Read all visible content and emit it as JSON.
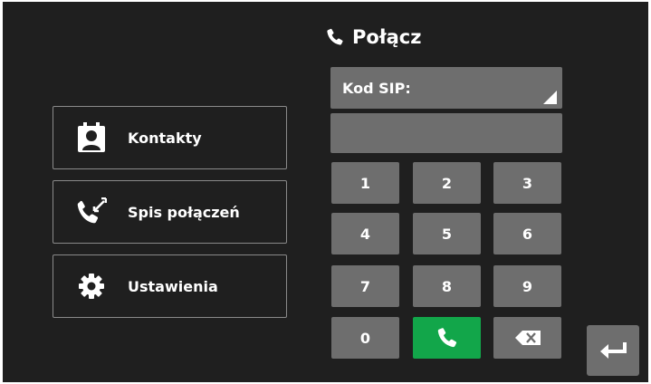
{
  "header": {
    "title": "Połącz",
    "icon": "phone-icon"
  },
  "menu": [
    {
      "label": "Kontakty",
      "icon": "contacts-icon"
    },
    {
      "label": "Spis połączeń",
      "icon": "call-log-icon"
    },
    {
      "label": "Ustawienia",
      "icon": "gear-icon"
    }
  ],
  "sip": {
    "label": "Kod SIP:",
    "value": ""
  },
  "keypad": {
    "keys": [
      "1",
      "2",
      "3",
      "4",
      "5",
      "6",
      "7",
      "8",
      "9",
      "0"
    ],
    "call_icon": "phone-icon",
    "backspace_icon": "backspace-icon"
  },
  "back_icon": "return-arrow-icon",
  "colors": {
    "background": "#1f1f1f",
    "button": "#6e6e6e",
    "call": "#12a64a",
    "border": "#8a8a8a"
  }
}
